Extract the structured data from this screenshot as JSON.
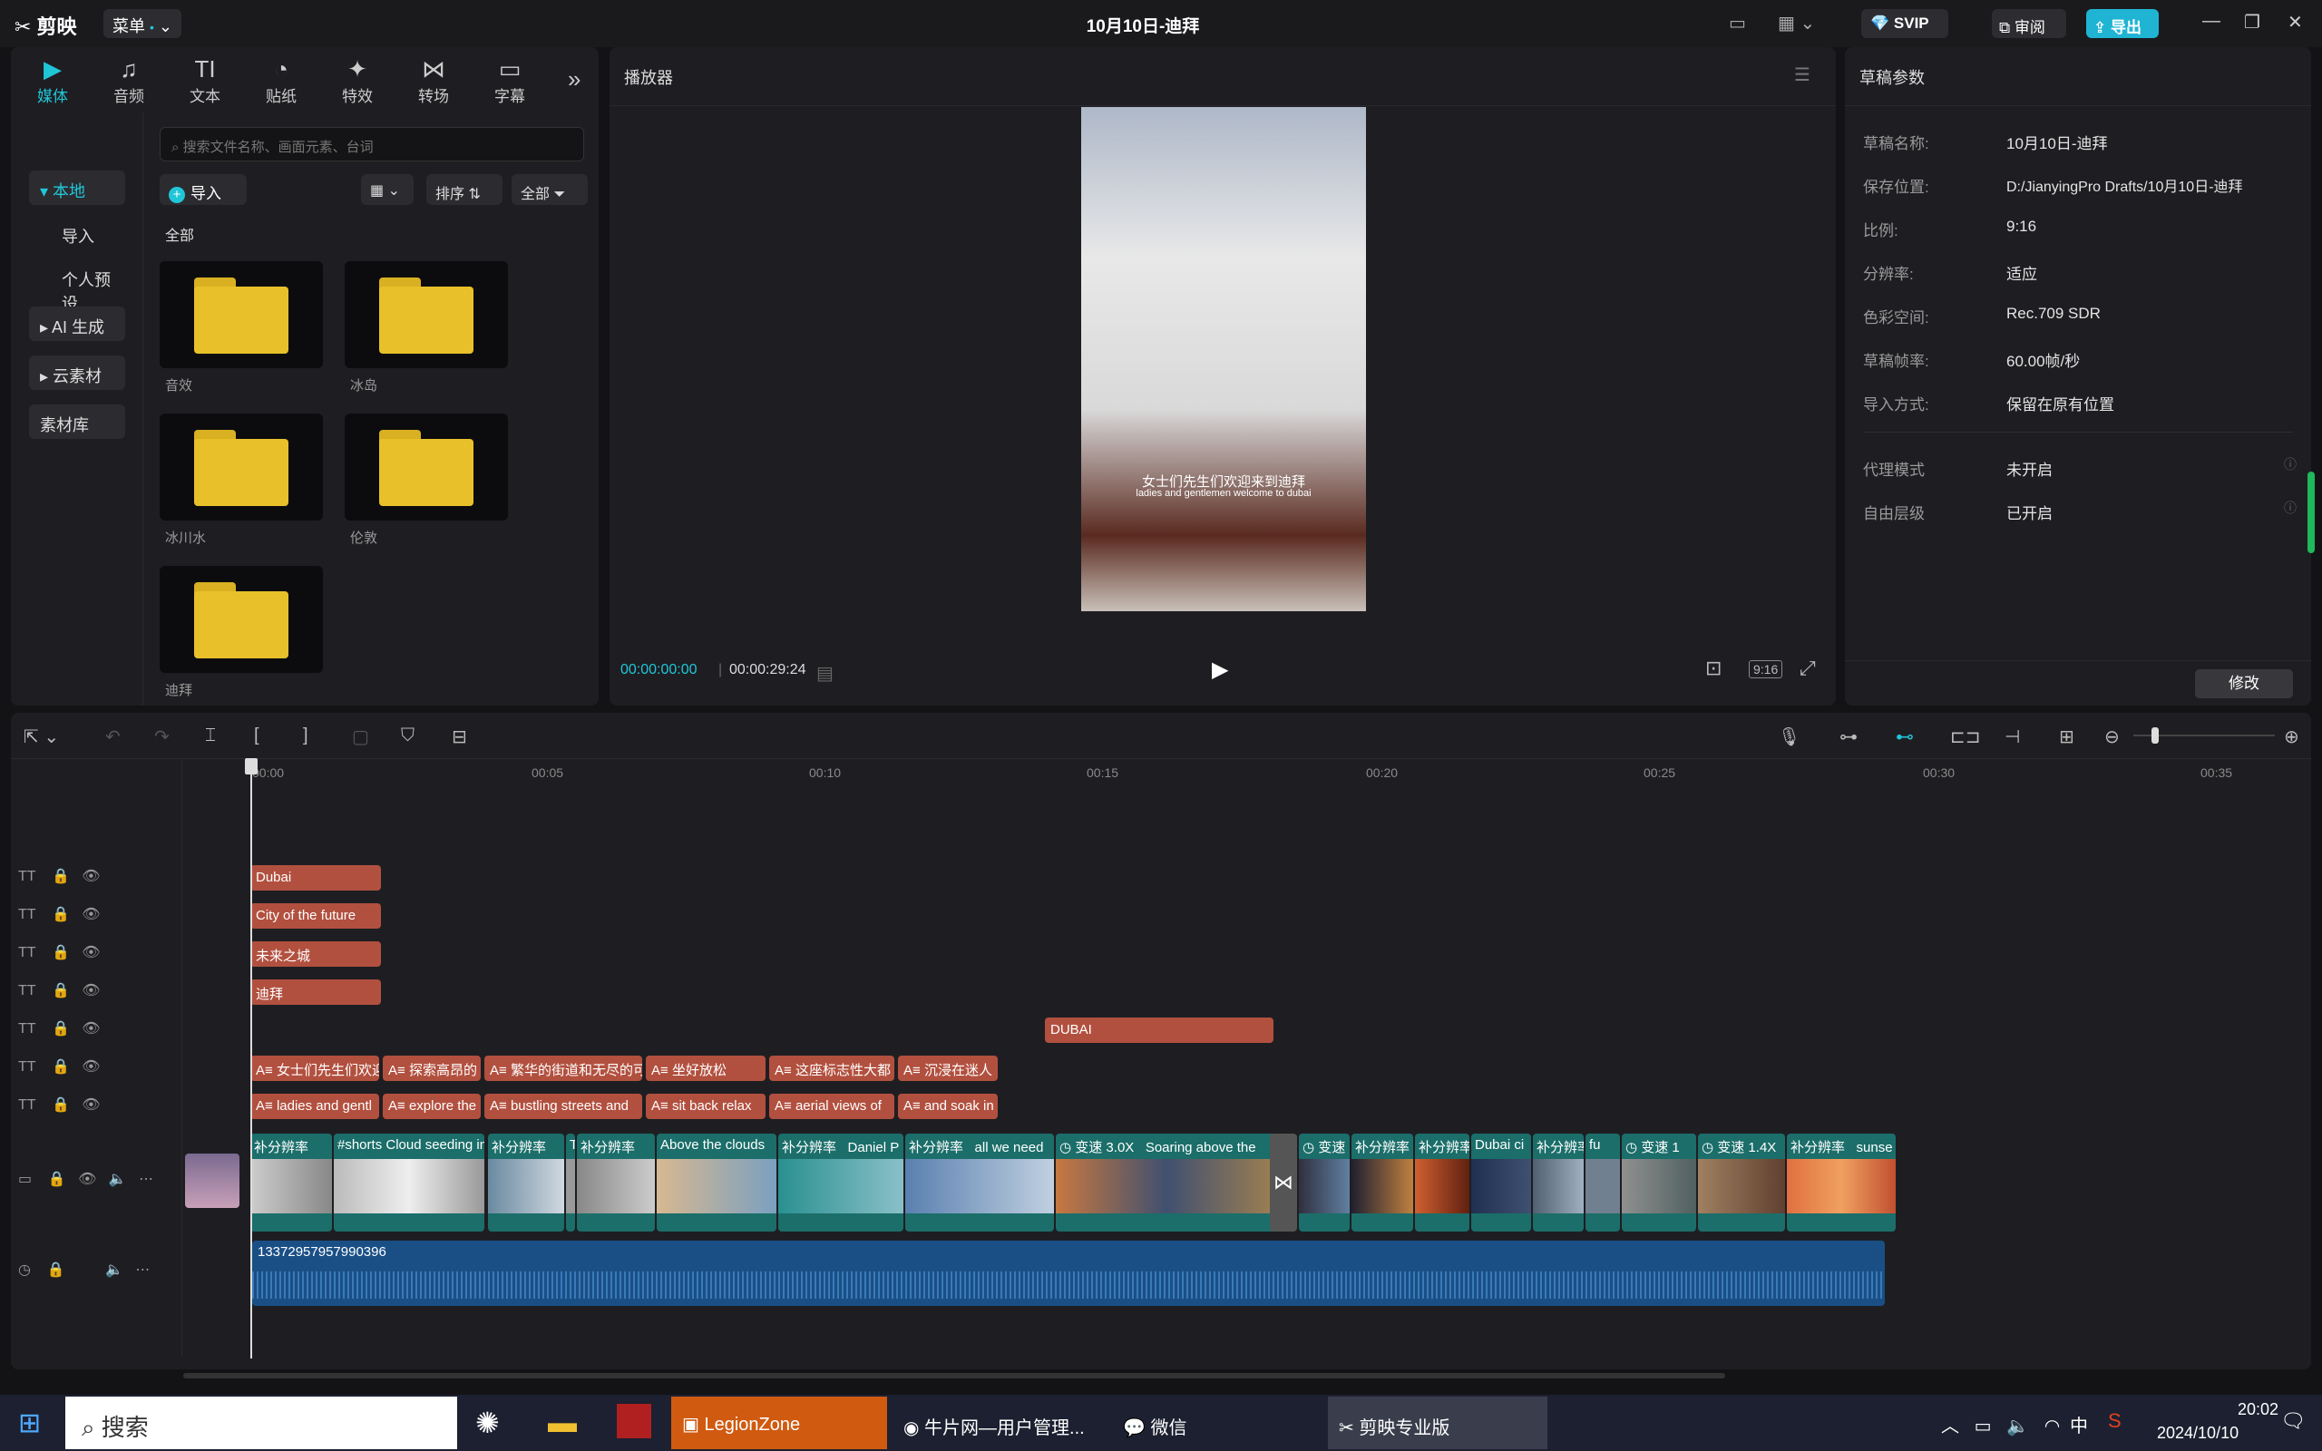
{
  "titlebar": {
    "logo": "剪映",
    "menu": "菜单",
    "title": "10月10日-迪拜",
    "svip": "SVIP",
    "review": "审阅",
    "export": "导出"
  },
  "media_tabs": [
    {
      "icon": "▶",
      "label": "媒体"
    },
    {
      "icon": "♫",
      "label": "音频"
    },
    {
      "icon": "TI",
      "label": "文本"
    },
    {
      "icon": "◔",
      "label": "贴纸"
    },
    {
      "icon": "✦",
      "label": "特效"
    },
    {
      "icon": "⋈",
      "label": "转场"
    },
    {
      "icon": "▭",
      "label": "字幕"
    }
  ],
  "sidebar": {
    "local": "本地",
    "import": "导入",
    "preset": "个人预设",
    "ai": "AI 生成",
    "cloud": "云素材",
    "library": "素材库"
  },
  "media": {
    "search_placeholder": "搜索文件名称、画面元素、台词",
    "import_btn": "导入",
    "sort": "排序",
    "filter": "全部",
    "section": "全部",
    "folders": [
      "音效",
      "冰岛",
      "冰川水",
      "伦敦",
      "迪拜"
    ]
  },
  "player": {
    "header": "播放器",
    "caption_cn": "女士们先生们欢迎来到迪拜",
    "caption_en": "ladies and gentlemen welcome to dubai",
    "time_current": "00:00:00:00",
    "time_total": "00:00:29:24",
    "ratio": "9:16"
  },
  "params": {
    "header": "草稿参数",
    "rows": [
      {
        "label": "草稿名称:",
        "value": "10月10日-迪拜"
      },
      {
        "label": "保存位置:",
        "value": "D:/JianyingPro Drafts/10月10日-迪拜"
      },
      {
        "label": "比例:",
        "value": "9:16"
      },
      {
        "label": "分辨率:",
        "value": "适应"
      },
      {
        "label": "色彩空间:",
        "value": "Rec.709 SDR"
      },
      {
        "label": "草稿帧率:",
        "value": "60.00帧/秒"
      },
      {
        "label": "导入方式:",
        "value": "保留在原有位置"
      },
      {
        "label": "代理模式",
        "value": "未开启"
      },
      {
        "label": "自由层级",
        "value": "已开启"
      }
    ],
    "modify": "修改"
  },
  "timeline": {
    "ruler": [
      "00:00",
      "00:05",
      "00:10",
      "00:15",
      "00:20",
      "00:25",
      "00:30",
      "00:35"
    ],
    "title_clips": [
      "Dubai",
      "City of the future",
      "未来之城",
      "迪拜",
      "DUBAI"
    ],
    "sub_cn": [
      "女士们先生们欢迎",
      "探索高昂的",
      "繁华的街道和无尽的可",
      "坐好放松",
      "这座标志性大都",
      "沉浸在迷人"
    ],
    "sub_en": [
      "ladies and gentl",
      "explore the",
      "bustling streets and",
      "sit back relax",
      "aerial views of",
      "and soak in"
    ],
    "video_clips": [
      "补分辨率",
      "#shorts Cloud seeding in",
      "补分辨率",
      "T",
      "补分辨率",
      "Above the clouds",
      "补分辨率",
      "Daniel P",
      "补分辨率",
      "all we need",
      "变速 3.0X",
      "Soaring above the",
      "变速",
      "补分辨率",
      "补分辨率",
      "Dubai ci",
      "补分辨率",
      "fu",
      "变速 1",
      "变速 1.4X",
      "补分辨率",
      "sunse"
    ],
    "audio_label": "13372957957990396"
  },
  "taskbar": {
    "search": "搜索",
    "apps": [
      "LegionZone",
      "牛片网—用户管理...",
      "微信",
      "剪映专业版"
    ],
    "ime": "中",
    "time": "20:02",
    "date": "2024/10/10",
    "notif": "1"
  }
}
